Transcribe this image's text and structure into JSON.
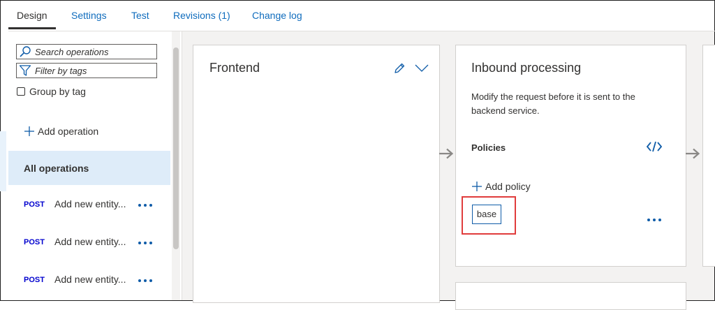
{
  "tabs": [
    {
      "label": "Design",
      "active": true
    },
    {
      "label": "Settings",
      "active": false
    },
    {
      "label": "Test",
      "active": false
    },
    {
      "label": "Revisions (1)",
      "active": false
    },
    {
      "label": "Change log",
      "active": false
    }
  ],
  "sidebar": {
    "search_placeholder": "Search operations",
    "filter_placeholder": "Filter by tags",
    "group_by_tag_label": "Group by tag",
    "group_by_tag_checked": false,
    "add_operation_label": "Add operation",
    "all_operations_label": "All operations",
    "operations": [
      {
        "method": "POST",
        "name": "Add new entity..."
      },
      {
        "method": "POST",
        "name": "Add new entity..."
      },
      {
        "method": "POST",
        "name": "Add new entity..."
      }
    ]
  },
  "frontend": {
    "title": "Frontend"
  },
  "inbound": {
    "title": "Inbound processing",
    "description_line1": "Modify the request before it is sent to the",
    "description_line2": "backend service.",
    "policies_label": "Policies",
    "add_policy_label": "Add policy",
    "base_policy_label": "base"
  },
  "icons": {
    "search": "search-icon",
    "filter": "filter-icon",
    "plus": "plus-icon",
    "more": "more-horizontal-icon",
    "pencil": "pencil-icon",
    "chevron": "chevron-down-icon",
    "code": "code-icon",
    "arrow": "arrow-right-icon"
  },
  "colors": {
    "accent": "#0f6cbd",
    "selected_bg": "#deecf9",
    "method_post": "#0000ce",
    "highlight": "#e03c3c",
    "canvas_bg": "#f3f2f1"
  }
}
